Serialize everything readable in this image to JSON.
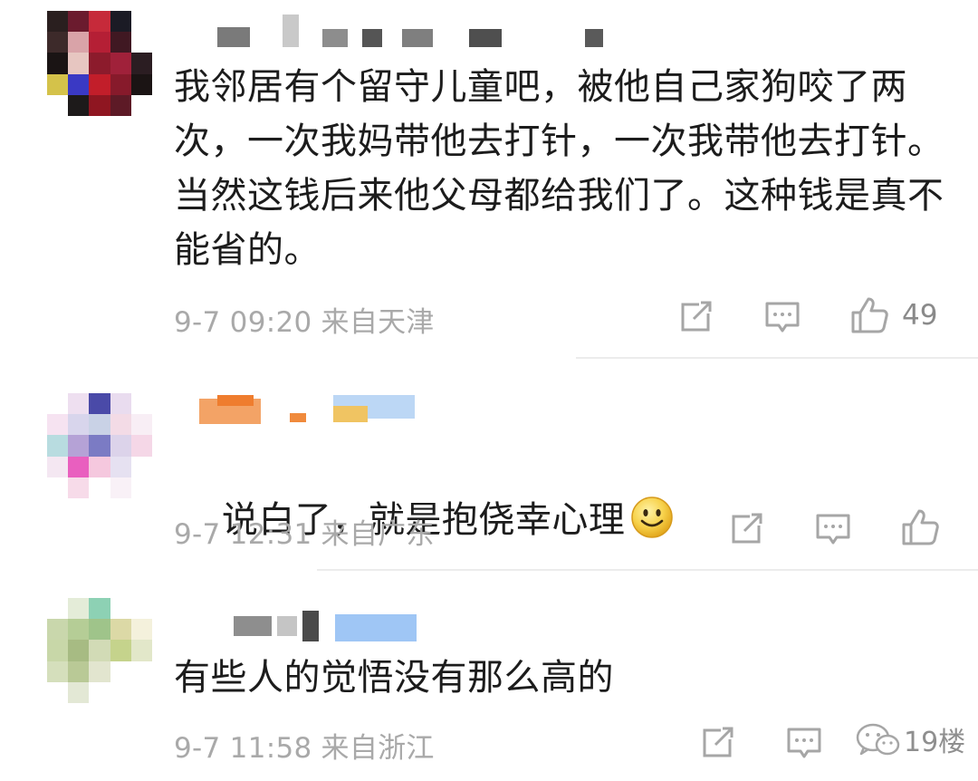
{
  "comments": [
    {
      "text": "我邻居有个留守儿童吧，被他自己家狗咬了两次，一次我妈带他去打针，一次我带他去打针。当然这钱后来他父母都给我们了。这种钱是真不能省的。",
      "time": "9-7 09:20",
      "location": "来自天津",
      "likes": "49",
      "avatar_colors": [
        "#2a1f1f",
        "#6b1b2e",
        "#c62a3a",
        "#1b1b25",
        "#ffffff",
        "#3d2a2a",
        "#d9a3a8",
        "#b51f35",
        "#401822",
        "#ffffff",
        "#1a1414",
        "#e7c6c1",
        "#8c1b2c",
        "#a0213a",
        "#2b1d22",
        "#d4c24a",
        "#3a39c4",
        "#c21e2a",
        "#871a2b",
        "#1b1414",
        "#ffffff",
        "#1d1a1a",
        "#8f1621",
        "#5d1a26",
        "#ffffff"
      ],
      "avatar_icon": "blurred-avatar",
      "name_icon": "blurred-username",
      "share_icon": "share-icon",
      "comment_icon": "comment-icon",
      "like_icon": "thumbs-up-icon"
    },
    {
      "text": "说白了，就是抱侥幸心理",
      "emoji": "smiley-emoji",
      "time": "9-7 12:31",
      "location": "来自广东",
      "avatar_colors": [
        "#ffffff",
        "#eedff0",
        "#4a4aa8",
        "#e9dcef",
        "#ffffff",
        "#f6e3f1",
        "#d8d5ec",
        "#c9d2e6",
        "#f3dbe6",
        "#f8eef5",
        "#b8dce0",
        "#b5a2d6",
        "#7b7bc4",
        "#dcd3ea",
        "#f5d7e7",
        "#f4e7f2",
        "#e95fbf",
        "#f5c8de",
        "#e6e1f1",
        "#ffffff",
        "#ffffff",
        "#f7dbe9",
        "#ffffff",
        "#f9f1f7",
        "#ffffff"
      ],
      "avatar_icon": "blurred-avatar",
      "name_icon": "blurred-username",
      "share_icon": "share-icon",
      "comment_icon": "comment-icon",
      "like_icon": "thumbs-up-icon"
    },
    {
      "text": "有些人的觉悟没有那么高的",
      "time": "9-7 11:58",
      "location": "来自浙江",
      "avatar_colors": [
        "#ffffff",
        "#e4ecd8",
        "#8dd1b4",
        "#ffffff",
        "#ffffff",
        "#c9d7ac",
        "#b5cd96",
        "#9fc48a",
        "#dcd9a6",
        "#f4f1dc",
        "#c8d7a8",
        "#a7bb83",
        "#d2dbb6",
        "#c5d38c",
        "#e2e7c9",
        "#d5dfbc",
        "#b9c996",
        "#e2e5cf",
        "#ffffff",
        "#ffffff",
        "#ffffff",
        "#e3e8d5",
        "#ffffff",
        "#ffffff",
        "#ffffff"
      ],
      "avatar_icon": "blurred-avatar",
      "name_icon": "blurred-username",
      "share_icon": "share-icon",
      "comment_icon": "comment-icon",
      "like_icon": "thumbs-up-icon"
    }
  ],
  "watermark": {
    "text": "19楼",
    "icon": "wechat-logo-icon"
  },
  "colors": {
    "text": "#1c1c1c",
    "meta": "#a9a9a9",
    "icon": "#a6a6a6",
    "divider": "#ececec"
  }
}
